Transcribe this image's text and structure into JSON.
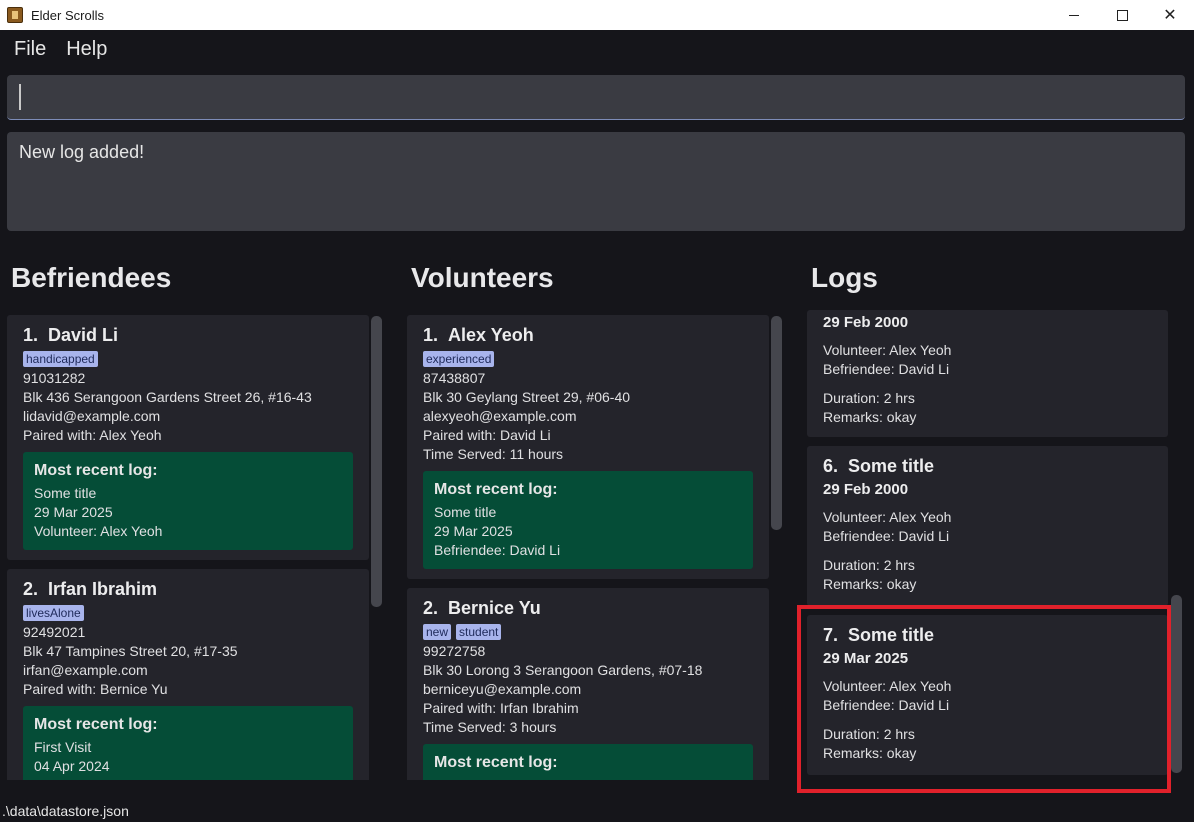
{
  "window": {
    "title": "Elder Scrolls",
    "minimize": "",
    "maximize": "",
    "close": "✕"
  },
  "menu": {
    "file": "File",
    "help": "Help"
  },
  "command": {
    "value": ""
  },
  "result": {
    "text": "New log added!"
  },
  "columns": {
    "befriendees": "Befriendees",
    "volunteers": "Volunteers",
    "logs": "Logs"
  },
  "befriendees": [
    {
      "index": "1.",
      "name": "David Li",
      "tags": [
        "handicapped"
      ],
      "phone": "91031282",
      "address": "Blk 436 Serangoon Gardens Street 26, #16-43",
      "email": "lidavid@example.com",
      "paired": "Paired with: Alex Yeoh",
      "recent": {
        "heading": "Most recent log:",
        "title": "Some title",
        "date": "29 Mar 2025",
        "person": "Volunteer: Alex Yeoh"
      }
    },
    {
      "index": "2.",
      "name": "Irfan Ibrahim",
      "tags": [
        "livesAlone"
      ],
      "phone": "92492021",
      "address": "Blk 47 Tampines Street 20, #17-35",
      "email": "irfan@example.com",
      "paired": "Paired with: Bernice Yu",
      "recent": {
        "heading": "Most recent log:",
        "title": "First Visit",
        "date": "04 Apr 2024",
        "person": ""
      }
    }
  ],
  "volunteers": [
    {
      "index": "1.",
      "name": "Alex Yeoh",
      "tags": [
        "experienced"
      ],
      "phone": "87438807",
      "address": "Blk 30 Geylang Street 29, #06-40",
      "email": "alexyeoh@example.com",
      "paired": "Paired with: David Li",
      "served": "Time Served: 11 hours",
      "recent": {
        "heading": "Most recent log:",
        "title": "Some title",
        "date": "29 Mar 2025",
        "person": "Befriendee: David Li"
      }
    },
    {
      "index": "2.",
      "name": "Bernice Yu",
      "tags": [
        "new",
        "student"
      ],
      "phone": "99272758",
      "address": "Blk 30 Lorong 3 Serangoon Gardens, #07-18",
      "email": "berniceyu@example.com",
      "paired": "Paired with: Irfan Ibrahim",
      "served": "Time Served: 3 hours",
      "recent": {
        "heading": "Most recent log:"
      }
    }
  ],
  "logs": [
    {
      "index": "",
      "title": "",
      "date": "29 Feb 2000",
      "volunteer": "Volunteer: Alex Yeoh",
      "befriendee": "Befriendee: David Li",
      "duration": "Duration: 2 hrs",
      "remarks": "Remarks: okay"
    },
    {
      "index": "6.",
      "title": "Some title",
      "date": "29 Feb 2000",
      "volunteer": "Volunteer: Alex Yeoh",
      "befriendee": "Befriendee: David Li",
      "duration": "Duration: 2 hrs",
      "remarks": "Remarks: okay"
    },
    {
      "index": "7.",
      "title": "Some title",
      "date": "29 Mar 2025",
      "volunteer": "Volunteer: Alex Yeoh",
      "befriendee": "Befriendee: David Li",
      "duration": "Duration: 2 hrs",
      "remarks": "Remarks: okay"
    }
  ],
  "status": {
    "path": ".\\data\\datastore.json"
  },
  "colors": {
    "background": "#15151a",
    "card": "#24242b",
    "recent_log": "#054d37",
    "tag": "#a8b4ec",
    "highlight": "#e0212b"
  }
}
